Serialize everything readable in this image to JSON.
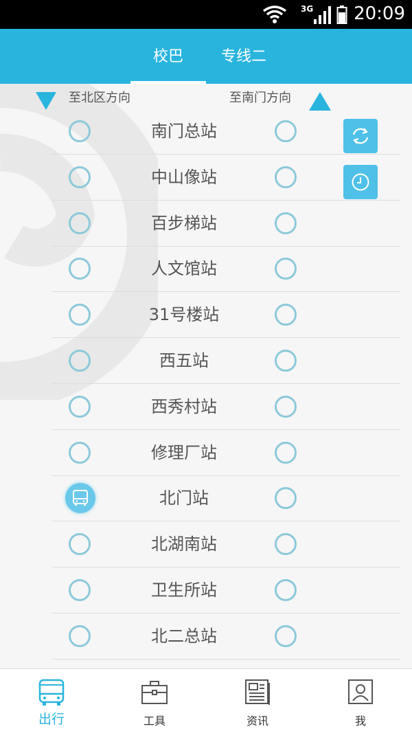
{
  "status_bar": {
    "time": "20:09",
    "network": "3G"
  },
  "header": {
    "tabs": [
      {
        "label": "校巴",
        "active": true
      },
      {
        "label": "专线二",
        "active": false
      }
    ]
  },
  "directions": {
    "left": "至北区方向",
    "right": "至南门方向"
  },
  "stops": [
    {
      "name": "南门总站",
      "bus_left": false
    },
    {
      "name": "中山像站",
      "bus_left": false
    },
    {
      "name": "百步梯站",
      "bus_left": false
    },
    {
      "name": "人文馆站",
      "bus_left": false
    },
    {
      "name": "31号楼站",
      "bus_left": false
    },
    {
      "name": "西五站",
      "bus_left": false
    },
    {
      "name": "西秀村站",
      "bus_left": false
    },
    {
      "name": "修理厂站",
      "bus_left": false
    },
    {
      "name": "北门站",
      "bus_left": true
    },
    {
      "name": "北湖南站",
      "bus_left": false
    },
    {
      "name": "卫生所站",
      "bus_left": false
    },
    {
      "name": "北二总站",
      "bus_left": false
    }
  ],
  "side_buttons": [
    {
      "icon": "refresh-icon"
    },
    {
      "icon": "clock-icon"
    }
  ],
  "bottom_nav": [
    {
      "label": "出行",
      "icon": "bus-icon",
      "active": true
    },
    {
      "label": "工具",
      "icon": "toolbox-icon",
      "active": false
    },
    {
      "label": "资讯",
      "icon": "news-icon",
      "active": false
    },
    {
      "label": "我",
      "icon": "user-icon",
      "active": false
    }
  ],
  "colors": {
    "accent": "#29b4de",
    "ring": "#8cc9da",
    "bus_marker": "#6ac8ea"
  }
}
